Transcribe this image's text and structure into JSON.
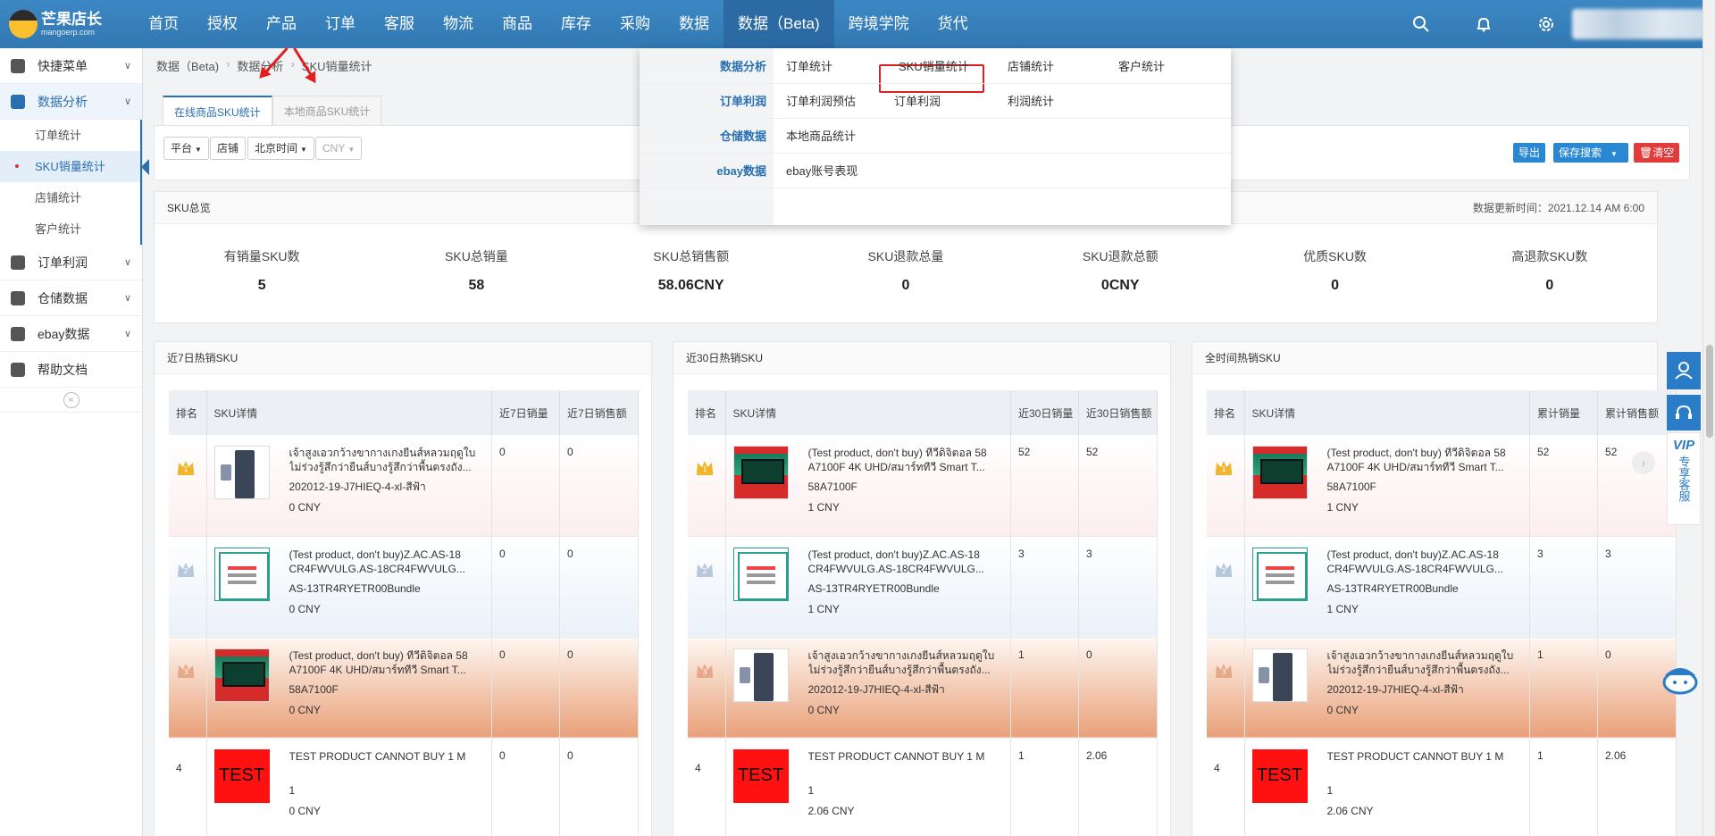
{
  "logo": {
    "cn": "芒果店长",
    "en": "mangoerp.com"
  },
  "nav": [
    "首页",
    "授权",
    "产品",
    "订单",
    "客服",
    "物流",
    "商品",
    "库存",
    "采购",
    "数据",
    "数据（Beta)",
    "跨境学院",
    "货代"
  ],
  "nav_active_index": 10,
  "top_icons": [
    "search-icon",
    "bell-icon",
    "gear-icon"
  ],
  "sidebar": {
    "groups": [
      {
        "label": "快捷菜单",
        "icon": "gear-icon"
      },
      {
        "label": "数据分析",
        "icon": "chart-icon",
        "active": true,
        "items": [
          "订单统计",
          "SKU销量统计",
          "店铺统计",
          "客户统计"
        ],
        "active_item": 1
      },
      {
        "label": "订单利润",
        "icon": "chart-icon"
      },
      {
        "label": "仓储数据",
        "icon": "chart-icon"
      },
      {
        "label": "ebay数据",
        "icon": "chart-icon"
      },
      {
        "label": "帮助文档",
        "icon": "help-icon"
      }
    ],
    "collapse": "«"
  },
  "breadcrumb": [
    "数据（Beta)",
    "数据分析",
    "SKU销量统计"
  ],
  "tabs": [
    "在线商品SKU统计",
    "本地商品SKU统计"
  ],
  "filters": {
    "platform": "平台",
    "shop": "店铺",
    "timezone": "北京时间",
    "currency": "CNY"
  },
  "actions": {
    "export": "导出",
    "save_search": "保存搜索",
    "clear": "清空",
    "export_color": "#2a88d2",
    "save_color": "#2a88d2",
    "clear_color": "#e03c3c"
  },
  "overview": {
    "title": "SKU总览",
    "update_time": "数据更新时间：2021.12.14 AM 6:00",
    "stats": [
      {
        "label": "有销量SKU数",
        "value": "5"
      },
      {
        "label": "SKU总销量",
        "value": "58"
      },
      {
        "label": "SKU总销售额",
        "value": "58.06CNY"
      },
      {
        "label": "SKU退款总量",
        "value": "0"
      },
      {
        "label": "SKU退款总额",
        "value": "0CNY"
      },
      {
        "label": "优质SKU数",
        "value": "0"
      },
      {
        "label": "高退款SKU数",
        "value": "0"
      }
    ]
  },
  "panels": [
    {
      "title": "近7日热销SKU",
      "headers": [
        "排名",
        "SKU详情",
        "近7日销量",
        "近7日销售额"
      ],
      "rows": [
        {
          "rank": "1",
          "thumb": "pants",
          "name": "เจ้าสูงเอวกว้างขากางเกงยีนส์หลวมฤดูใบไม่ร่วงรู้สึกว่ายืนส์บางรู้สึกว่าพื้นตรงถัง...",
          "code": "202012-19-J7HIEQ-4-xl-สีฟ้า",
          "price": "0 CNY",
          "qty": "0",
          "amount": "0"
        },
        {
          "rank": "2",
          "thumb": "doc",
          "name": "(Test product, don't buy)Z.AC.AS-18 CR4FWVULG.AS-18CR4FWVULG...",
          "code": "AS-13TR4RYETR00Bundle",
          "price": "0 CNY",
          "qty": "0",
          "amount": "0"
        },
        {
          "rank": "3",
          "thumb": "tv",
          "name": "(Test product, don't buy) ทีวีดิจิตอล 58 A7100F 4K UHD/สมาร์ททีวี Smart T...",
          "code": "58A7100F",
          "price": "0 CNY",
          "qty": "0",
          "amount": "0"
        },
        {
          "rank": "4",
          "thumb": "test",
          "name": "TEST PRODUCT CANNOT BUY 1 M",
          "code": "1",
          "price": "0 CNY",
          "qty": "0",
          "amount": "0"
        }
      ]
    },
    {
      "title": "近30日热销SKU",
      "headers": [
        "排名",
        "SKU详情",
        "近30日销量",
        "近30日销售额"
      ],
      "rows": [
        {
          "rank": "1",
          "thumb": "tv",
          "name": "(Test product, don't buy) ทีวีดิจิตอล 58 A7100F 4K UHD/สมาร์ททีวี Smart T...",
          "code": "58A7100F",
          "price": "1 CNY",
          "qty": "52",
          "amount": "52"
        },
        {
          "rank": "2",
          "thumb": "doc",
          "name": "(Test product, don't buy)Z.AC.AS-18 CR4FWVULG.AS-18CR4FWVULG...",
          "code": "AS-13TR4RYETR00Bundle",
          "price": "1 CNY",
          "qty": "3",
          "amount": "3"
        },
        {
          "rank": "3",
          "thumb": "pants",
          "name": "เจ้าสูงเอวกว้างขากางเกงยีนส์หลวมฤดูใบไม่ร่วงรู้สึกว่ายืนส์บางรู้สึกว่าพื้นตรงถัง...",
          "code": "202012-19-J7HIEQ-4-xl-สีฟ้า",
          "price": "0 CNY",
          "qty": "1",
          "amount": "0"
        },
        {
          "rank": "4",
          "thumb": "test",
          "name": "TEST PRODUCT CANNOT BUY 1 M",
          "code": "1",
          "price": "2.06 CNY",
          "qty": "1",
          "amount": "2.06"
        }
      ]
    },
    {
      "title": "全时间热销SKU",
      "headers": [
        "排名",
        "SKU详情",
        "累计销量",
        "累计销售额"
      ],
      "rows": [
        {
          "rank": "1",
          "thumb": "tv",
          "name": "(Test product, don't buy) ทีวีดิจิตอล 58 A7100F 4K UHD/สมาร์ททีวี Smart T...",
          "code": "58A7100F",
          "price": "1 CNY",
          "qty": "52",
          "amount": "52"
        },
        {
          "rank": "2",
          "thumb": "doc",
          "name": "(Test product, don't buy)Z.AC.AS-18 CR4FWVULG.AS-18CR4FWVULG...",
          "code": "AS-13TR4RYETR00Bundle",
          "price": "1 CNY",
          "qty": "3",
          "amount": "3"
        },
        {
          "rank": "3",
          "thumb": "pants",
          "name": "เจ้าสูงเอวกว้างขากางเกงยีนส์หลวมฤดูใบไม่ร่วงรู้สึกว่ายืนส์บางรู้สึกว่าพื้นตรงถัง...",
          "code": "202012-19-J7HIEQ-4-xl-สีฟ้า",
          "price": "0 CNY",
          "qty": "1",
          "amount": "0"
        },
        {
          "rank": "4",
          "thumb": "test",
          "name": "TEST PRODUCT CANNOT BUY 1 M",
          "code": "1",
          "price": "2.06 CNY",
          "qty": "1",
          "amount": "2.06"
        }
      ]
    }
  ],
  "dropdown": {
    "rows": [
      {
        "category": "数据分析",
        "links": [
          "订单统计",
          "SKU销量统计",
          "店铺统计",
          "客户统计"
        ]
      },
      {
        "category": "订单利润",
        "links": [
          "订单利润预估",
          "订单利润",
          "利润统计"
        ]
      },
      {
        "category": "仓储数据",
        "links": [
          "本地商品统计"
        ]
      },
      {
        "category": "ebay数据",
        "links": [
          "ebay账号表现"
        ]
      }
    ],
    "highlighted": "SKU销量统计"
  },
  "float": {
    "vip_text": "专享客服",
    "vip_badge": "VIP",
    "next": "›"
  },
  "thumb_test_text": "TEST"
}
